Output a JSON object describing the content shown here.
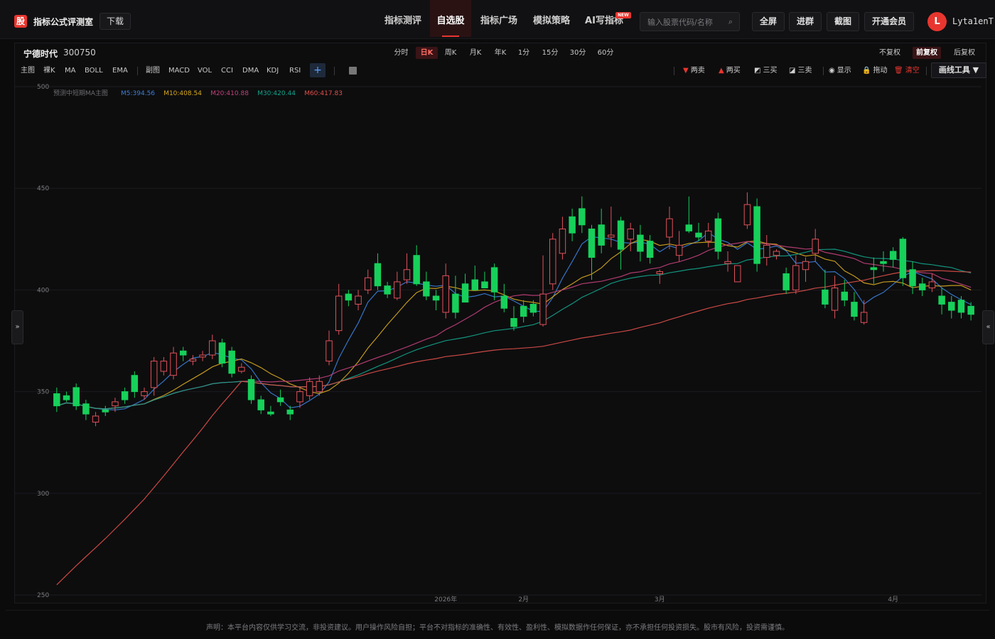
{
  "header": {
    "logo_glyph": "股",
    "brand": "指标公式评测室",
    "download": "下载",
    "nav": [
      "指标测评",
      "自选股",
      "指标广场",
      "模拟策略",
      "AI写指标"
    ],
    "active_nav": 1,
    "new_badge": "NEW",
    "search_placeholder": "输入股票代码/名称",
    "buttons": [
      "全屏",
      "进群",
      "截图",
      "开通会员"
    ],
    "avatar_letter": "L",
    "username": "Lyta1enT"
  },
  "stock": {
    "name": "宁德时代",
    "code": "300750"
  },
  "periods": [
    "分时",
    "日K",
    "周K",
    "月K",
    "年K",
    "1分",
    "15分",
    "30分",
    "60分"
  ],
  "active_period": 1,
  "adjust": [
    "不复权",
    "前复权",
    "后复权"
  ],
  "active_adjust": 1,
  "indicators_main": [
    "主图",
    "裸K",
    "MA",
    "BOLL",
    "EMA"
  ],
  "indicators_sub": [
    "副图",
    "MACD",
    "VOL",
    "CCI",
    "DMA",
    "KDJ",
    "RSI"
  ],
  "plus_label": "+",
  "drawing": {
    "items": [
      {
        "icon": "▼",
        "label": "两卖",
        "color": "#e8362f"
      },
      {
        "icon": "▲",
        "label": "两买",
        "color": "#e8362f"
      },
      {
        "icon": "◩",
        "label": "三买",
        "color": "#d0d0d0"
      },
      {
        "icon": "◪",
        "label": "三卖",
        "color": "#d0d0d0"
      },
      {
        "icon": "◉",
        "label": "显示",
        "color": "#d0d0d0"
      },
      {
        "icon": "🔒",
        "label": "拖动",
        "color": "#d0d0d0"
      },
      {
        "icon": "🗑",
        "label": "清空",
        "color": "#e8362f"
      }
    ],
    "tools_label": "画线工具 ▼"
  },
  "side_toggles": {
    "left": "»",
    "right": "«"
  },
  "chart_data": {
    "type": "candlestick",
    "legend_title": "预测中短期MA主图",
    "ma_legend": [
      {
        "label": "M5:394.56",
        "color": "#3b7fd9"
      },
      {
        "label": "M10:408.54",
        "color": "#d6a81f"
      },
      {
        "label": "M20:410.88",
        "color": "#c2407a"
      },
      {
        "label": "M30:420.44",
        "color": "#13a38a"
      },
      {
        "label": "M60:417.83",
        "color": "#e0504a"
      }
    ],
    "y_ticks": [
      500,
      450,
      400,
      350,
      300,
      250
    ],
    "ylim": [
      250,
      500
    ],
    "x_ticks": [
      {
        "label": "2026年",
        "index": 40
      },
      {
        "label": "2月",
        "index": 48
      },
      {
        "label": "3月",
        "index": 62
      },
      {
        "label": "4月",
        "index": 86
      }
    ],
    "up_color": "#e0525a",
    "down_color": "#17d05a",
    "candles": [
      [
        349,
        343,
        352,
        340
      ],
      [
        348,
        346,
        350,
        345
      ],
      [
        352,
        343,
        354,
        341
      ],
      [
        344,
        339,
        346,
        336
      ],
      [
        335,
        338,
        340,
        333
      ],
      [
        341,
        340,
        343,
        338
      ],
      [
        343,
        345,
        347,
        340
      ],
      [
        350,
        346,
        352,
        344
      ],
      [
        358,
        350,
        360,
        347
      ],
      [
        348,
        350,
        352,
        346
      ],
      [
        352,
        365,
        367,
        348
      ],
      [
        360,
        365,
        367,
        358
      ],
      [
        358,
        369,
        372,
        356
      ],
      [
        370,
        368,
        372,
        365
      ],
      [
        365,
        366,
        368,
        363
      ],
      [
        367,
        368,
        370,
        365
      ],
      [
        368,
        375,
        378,
        366
      ],
      [
        374,
        364,
        376,
        362
      ],
      [
        370,
        359,
        372,
        357
      ],
      [
        360,
        362,
        364,
        359
      ],
      [
        356,
        346,
        358,
        344
      ],
      [
        346,
        341,
        348,
        339
      ],
      [
        340,
        339,
        343,
        338
      ],
      [
        347,
        345,
        351,
        343
      ],
      [
        341,
        339,
        343,
        336
      ],
      [
        345,
        350,
        352,
        342
      ],
      [
        348,
        355,
        357,
        346
      ],
      [
        350,
        355,
        358,
        348
      ],
      [
        365,
        375,
        380,
        363
      ],
      [
        380,
        397,
        403,
        378
      ],
      [
        398,
        395,
        400,
        392
      ],
      [
        393,
        397,
        400,
        390
      ],
      [
        400,
        406,
        410,
        398
      ],
      [
        413,
        402,
        418,
        400
      ],
      [
        402,
        398,
        404,
        396
      ],
      [
        396,
        404,
        409,
        395
      ],
      [
        405,
        410,
        418,
        403
      ],
      [
        417,
        403,
        422,
        402
      ],
      [
        404,
        397,
        409,
        395
      ],
      [
        397,
        395,
        400,
        390
      ],
      [
        389,
        407,
        413,
        386
      ],
      [
        398,
        389,
        407,
        386
      ],
      [
        403,
        394,
        408,
        394
      ],
      [
        405,
        400,
        412,
        404
      ],
      [
        404,
        401,
        409,
        403
      ],
      [
        411,
        399,
        413,
        395
      ],
      [
        397,
        391,
        403,
        389
      ],
      [
        386,
        382,
        392,
        380
      ],
      [
        392,
        387,
        395,
        384
      ],
      [
        393,
        389,
        395,
        387
      ],
      [
        383,
        398,
        417,
        382
      ],
      [
        403,
        425,
        428,
        400
      ],
      [
        418,
        430,
        436,
        415
      ],
      [
        436,
        428,
        440,
        424
      ],
      [
        440,
        432,
        446,
        428
      ],
      [
        430,
        416,
        432,
        405
      ],
      [
        432,
        422,
        440,
        418
      ],
      [
        426,
        427,
        441,
        421
      ],
      [
        434,
        420,
        436,
        410
      ],
      [
        425,
        430,
        433,
        419
      ],
      [
        427,
        419,
        432,
        414
      ],
      [
        424,
        416,
        427,
        413
      ],
      [
        408,
        409,
        410,
        403
      ],
      [
        426,
        435,
        441,
        420
      ],
      [
        417,
        422,
        429,
        414
      ],
      [
        432,
        429,
        446,
        428
      ],
      [
        428,
        426,
        433,
        424
      ],
      [
        424,
        429,
        433,
        421
      ],
      [
        435,
        419,
        438,
        415
      ],
      [
        413,
        414,
        419,
        409
      ],
      [
        404,
        412,
        409,
        404
      ],
      [
        432,
        442,
        448,
        430
      ],
      [
        441,
        413,
        445,
        409
      ],
      [
        416,
        422,
        427,
        412
      ],
      [
        417,
        419,
        420,
        415
      ],
      [
        408,
        400,
        411,
        398
      ],
      [
        400,
        412,
        417,
        398
      ],
      [
        410,
        414,
        416,
        404
      ],
      [
        418,
        425,
        430,
        414
      ],
      [
        400,
        393,
        410,
        391
      ],
      [
        390,
        401,
        407,
        386
      ],
      [
        399,
        395,
        405,
        392
      ],
      [
        394,
        387,
        399,
        385
      ],
      [
        384,
        389,
        395,
        383
      ],
      [
        411,
        410,
        416,
        403
      ],
      [
        414,
        413,
        419,
        409
      ],
      [
        419,
        415,
        421,
        411
      ],
      [
        425,
        406,
        426,
        402
      ],
      [
        410,
        402,
        414,
        398
      ],
      [
        403,
        400,
        406,
        397
      ],
      [
        401,
        404,
        408,
        399
      ],
      [
        397,
        393,
        401,
        388
      ],
      [
        394,
        390,
        397,
        386
      ],
      [
        395,
        389,
        397,
        386
      ],
      [
        392,
        388,
        394,
        385
      ]
    ]
  },
  "disclaimer": "声明：本平台内容仅供学习交流，非投资建议。用户操作风险自担；平台不对指标的准确性、有效性、盈利性、模拟数据作任何保证，亦不承担任何投资损失。股市有风险，投资需谨慎。"
}
